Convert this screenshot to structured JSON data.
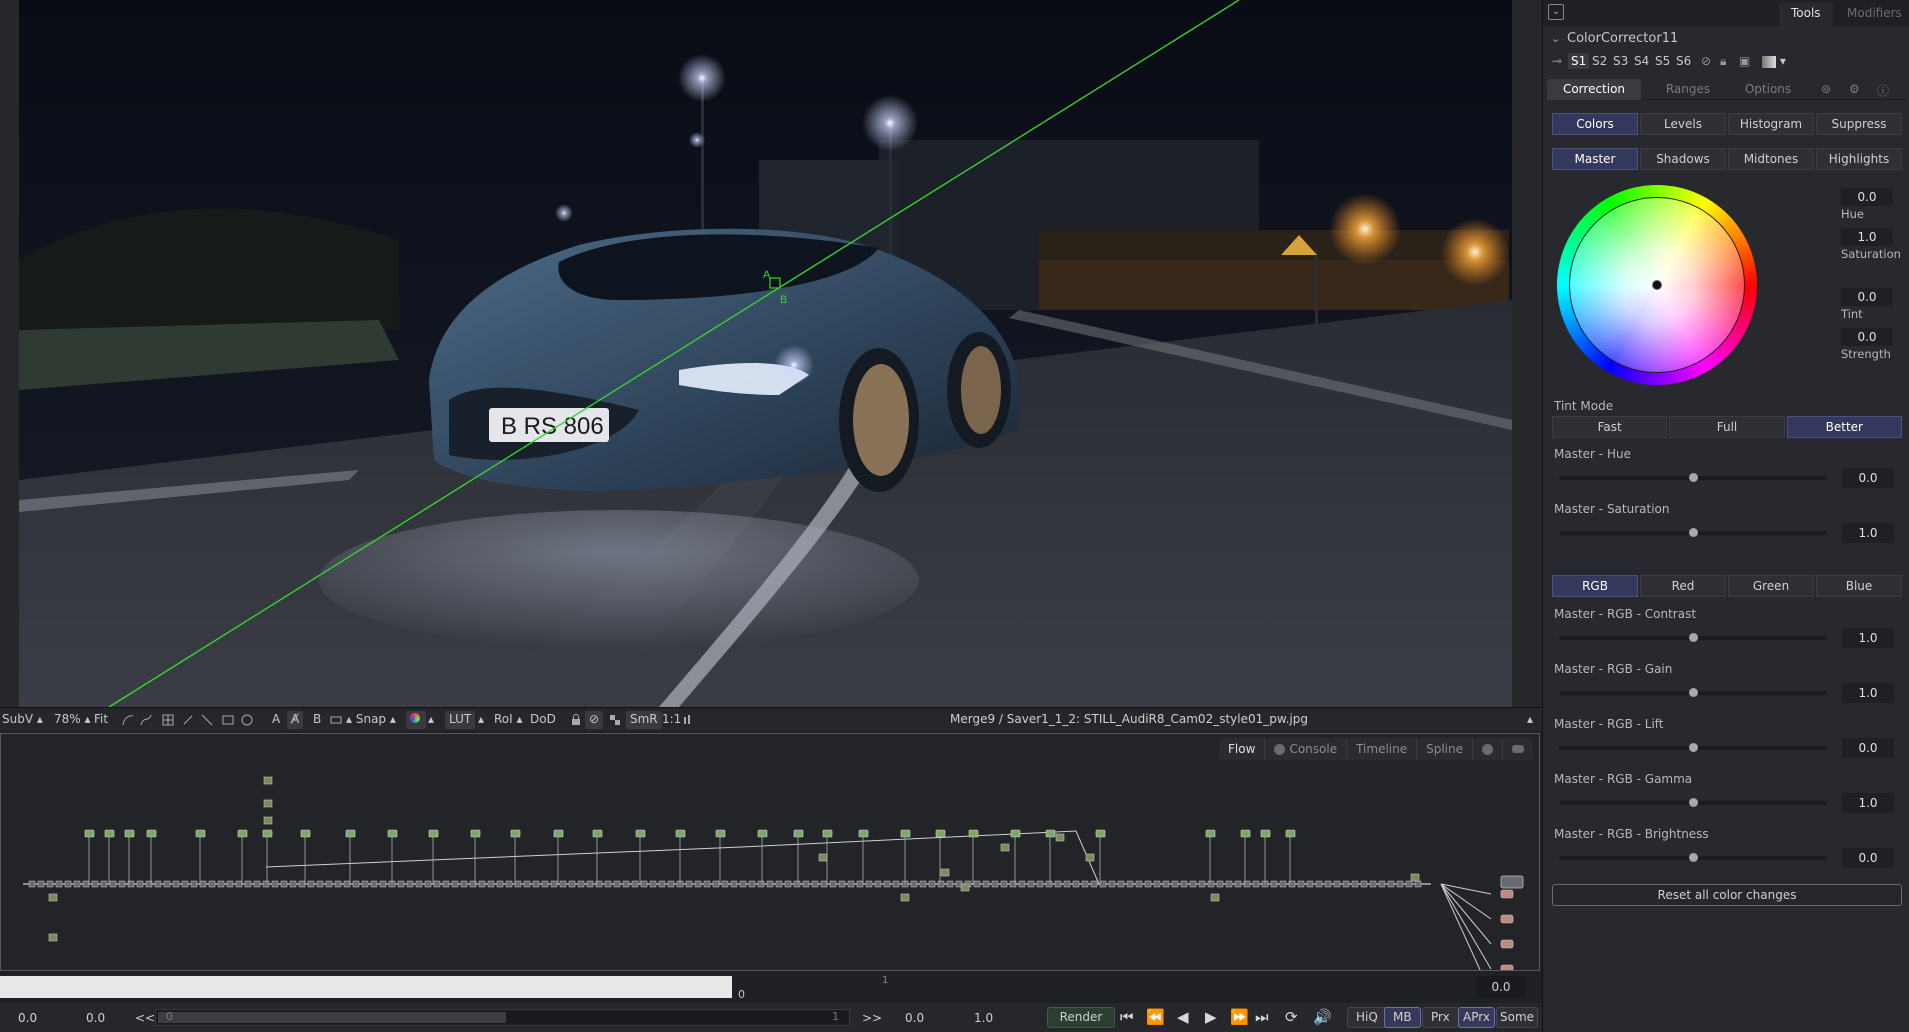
{
  "viewer": {
    "toolbar": {
      "subv": "SubV",
      "zoom": "78%",
      "fit": "Fit",
      "a": "A",
      "b": "B",
      "snap": "Snap",
      "lut": "LUT",
      "roi": "RoI",
      "dod": "DoD",
      "smr": "SmR",
      "ratio": "1:1",
      "title": "Merge9 / Saver1_1_2: STILL_AudiR8_Cam02_style01_pw.jpg"
    },
    "overlay": {
      "label_a": "A",
      "label_b": "B"
    },
    "image": {
      "plate": "B RS 806"
    }
  },
  "flow": {
    "tabs": [
      "Flow",
      "Console",
      "Timeline",
      "Spline"
    ]
  },
  "ruler": {
    "start": "0",
    "mark": "1",
    "current": "0.0"
  },
  "transport": {
    "global_start": "0.0",
    "render_start": "0.0",
    "rewind": "<<",
    "range_label": "0",
    "range_end": "1",
    "forward": ">>",
    "render_end": "0.0",
    "global_end": "1.0",
    "render": "Render",
    "hiq": "HiQ",
    "mb": "MB",
    "prx": "Prx",
    "aprx": "APrx",
    "some": "Some"
  },
  "inspector": {
    "tabs": {
      "tools": "Tools",
      "modifiers": "Modifiers"
    },
    "node_name": "ColorCorrector11",
    "scenes": [
      "S1",
      "S2",
      "S3",
      "S4",
      "S5",
      "S6"
    ],
    "sub_tabs": [
      "Correction",
      "Ranges",
      "Options"
    ],
    "mode_tabs": [
      "Colors",
      "Levels",
      "Histogram",
      "Suppress"
    ],
    "range_tabs": [
      "Master",
      "Shadows",
      "Midtones",
      "Highlights"
    ],
    "wheel": {
      "hue": "0.0",
      "hue_label": "Hue",
      "saturation": "1.0",
      "saturation_label": "Saturation",
      "tint": "0.0",
      "tint_label": "Tint",
      "strength": "0.0",
      "strength_label": "Strength"
    },
    "tint_mode": {
      "label": "Tint Mode",
      "options": [
        "Fast",
        "Full",
        "Better"
      ]
    },
    "master_hue": {
      "label": "Master - Hue",
      "value": "0.0"
    },
    "master_saturation": {
      "label": "Master - Saturation",
      "value": "1.0"
    },
    "channel_tabs": [
      "RGB",
      "Red",
      "Green",
      "Blue"
    ],
    "rgb_sliders": [
      {
        "label": "Master - RGB - Contrast",
        "value": "1.0"
      },
      {
        "label": "Master - RGB - Gain",
        "value": "1.0"
      },
      {
        "label": "Master - RGB - Lift",
        "value": "0.0"
      },
      {
        "label": "Master - RGB - Gamma",
        "value": "1.0"
      },
      {
        "label": "Master - RGB - Brightness",
        "value": "0.0"
      }
    ],
    "reset": "Reset all color changes"
  },
  "colors": {
    "accent": "#34385c",
    "overlay_line": "#39d130",
    "panel": "#28292e"
  }
}
